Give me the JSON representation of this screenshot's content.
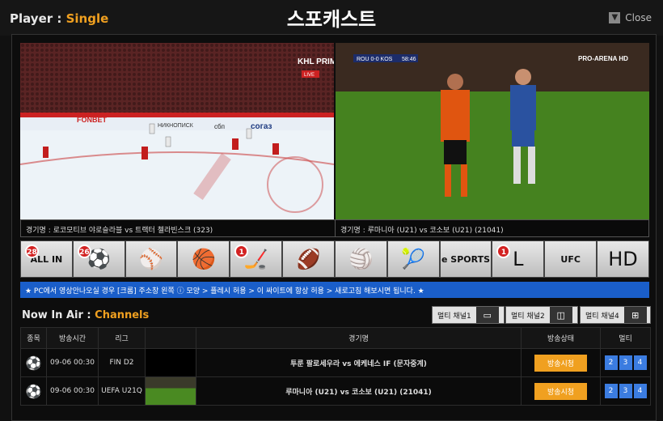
{
  "header": {
    "player_label": "Player : ",
    "player_mode": "Single",
    "title": "스포캐스트",
    "close_label": "Close"
  },
  "videos": {
    "left_caption": "경기명 : 로코모티브 야로슬라블 vs 트랙터 첼라빈스크 (323)",
    "right_caption": "경기명 : 루마니아 (U21) vs 코소보 (U21) (21041)",
    "right_score": "ROU 0-0 KOS",
    "right_time": "58:46",
    "right_channel": "PRO-ARENA HD",
    "left_channel": "KHL PRIME",
    "left_live": "LIVE",
    "left_boards": [
      "FONBET",
      "НИКНОПИСК",
      "сбп",
      "согаз"
    ]
  },
  "sports": [
    {
      "name": "all-in",
      "glyph": "ALL IN",
      "badge": "28"
    },
    {
      "name": "soccer",
      "glyph": "⚽",
      "badge": "26"
    },
    {
      "name": "baseball",
      "glyph": "⚾",
      "badge": ""
    },
    {
      "name": "basketball",
      "glyph": "🏀",
      "badge": ""
    },
    {
      "name": "hockey",
      "glyph": "🏒",
      "badge": "1"
    },
    {
      "name": "football",
      "glyph": "🏈",
      "badge": ""
    },
    {
      "name": "volleyball",
      "glyph": "🏐",
      "badge": ""
    },
    {
      "name": "tennis",
      "glyph": "🎾",
      "badge": ""
    },
    {
      "name": "esports",
      "glyph": "e SPORTS",
      "badge": ""
    },
    {
      "name": "lol",
      "glyph": "L",
      "badge": "1"
    },
    {
      "name": "ufc",
      "glyph": "UFC",
      "badge": ""
    },
    {
      "name": "hd",
      "glyph": "HD",
      "badge": ""
    }
  ],
  "notice": "★ PC에서 영상안나오실 경우 [크롬] 주소창 왼쪽 ⓘ 모양 > 플레시 허용 > 이 싸이트에 항상 허용 > 새로고침 해보시면 됩니다. ★",
  "now_in_air": {
    "label": "Now In Air : ",
    "accent": "Channels"
  },
  "multi_buttons": [
    "멀티 채널1",
    "멀티 채널2",
    "멀티 채널4"
  ],
  "table": {
    "headers": [
      "종목",
      "방송시간",
      "리그",
      "",
      "경기명",
      "방송상태",
      "멀티"
    ],
    "rows": [
      {
        "time": "09-06 00:30",
        "league": "FIN D2",
        "match": "투룬 팔로세우라 vs 에케네스 IF (문자중계)",
        "status": "방송시청",
        "multi": [
          "2",
          "3",
          "4"
        ]
      },
      {
        "time": "09-06 00:30",
        "league": "UEFA U21Q",
        "match": "루마니아 (U21) vs 코소보 (U21) (21041)",
        "status": "방송시청",
        "multi": [
          "2",
          "3",
          "4"
        ]
      }
    ]
  }
}
